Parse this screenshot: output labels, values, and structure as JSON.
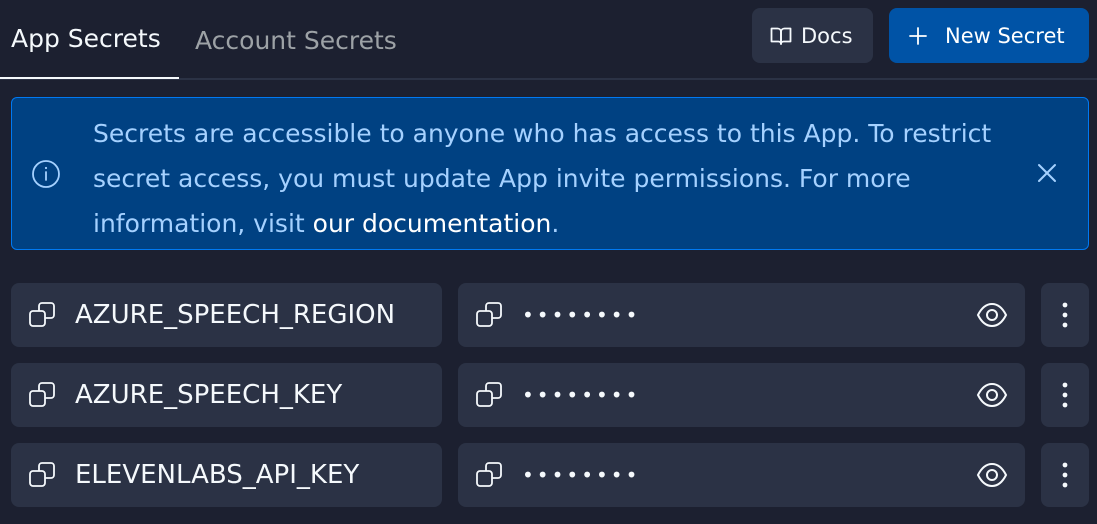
{
  "tabs": [
    {
      "label": "App Secrets",
      "active": true
    },
    {
      "label": "Account Secrets",
      "active": false
    }
  ],
  "toolbar": {
    "docs_label": "Docs",
    "new_secret_label": "New Secret"
  },
  "banner": {
    "text": "Secrets are accessible to anyone who has access to this App. To restrict secret access, you must update App invite permissions. For more information, visit ",
    "link_text": "our documentation",
    "trailing": "."
  },
  "secrets": [
    {
      "key": "AZURE_SPEECH_REGION",
      "value": "••••••••"
    },
    {
      "key": "AZURE_SPEECH_KEY",
      "value": "••••••••"
    },
    {
      "key": "ELEVENLABS_API_KEY",
      "value": "••••••••"
    }
  ],
  "icons": {
    "docs": "book-icon",
    "new": "plus-icon",
    "info": "info-icon",
    "close": "close-icon",
    "copy": "copy-icon",
    "reveal": "eye-icon",
    "menu": "more-vertical-icon"
  },
  "colors": {
    "background": "#1c2030",
    "surface": "#2b3245",
    "primary": "#0053a6",
    "banner_bg": "#004182",
    "banner_border": "#0079f2",
    "banner_text": "#a5d1ff"
  }
}
